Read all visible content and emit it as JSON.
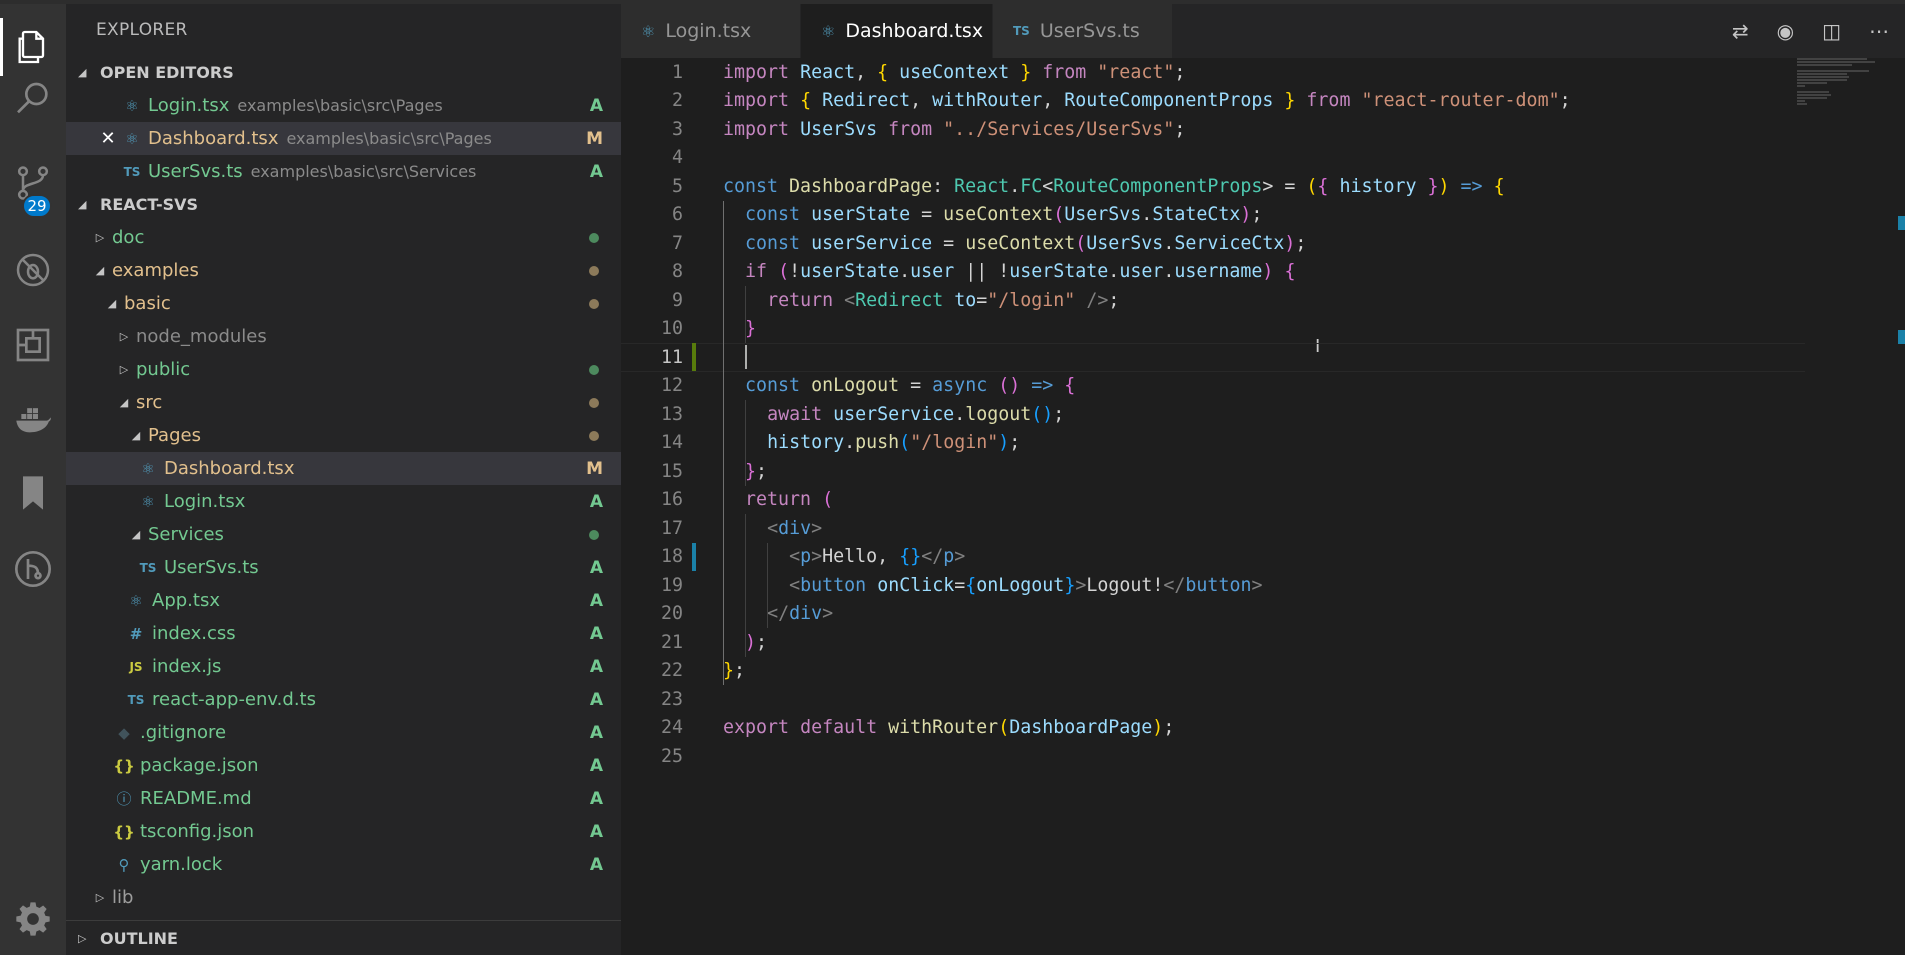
{
  "activity_bar": {
    "items": [
      "explorer-icon",
      "search-icon",
      "source-control-icon",
      "debug-icon",
      "extensions-icon",
      "docker-icon",
      "bookmarks-icon",
      "git-graph-icon"
    ],
    "scm_badge": "29",
    "settings": "gear-icon"
  },
  "sidebar": {
    "title": "EXPLORER",
    "open_editors_title": "OPEN EDITORS",
    "open_editors": [
      {
        "name": "Login.tsx",
        "path": "examples\\basic\\src\\Pages",
        "status": "A",
        "icon": "react-icon"
      },
      {
        "name": "Dashboard.tsx",
        "path": "examples\\basic\\src\\Pages",
        "status": "M",
        "icon": "react-icon",
        "close": "✕"
      },
      {
        "name": "UserSvs.ts",
        "path": "examples\\basic\\src\\Services",
        "status": "A",
        "icon": "TS"
      }
    ],
    "project_title": "REACT-SVS",
    "tree": [
      {
        "name": "doc"
      },
      {
        "name": "examples"
      },
      {
        "name": "basic"
      },
      {
        "name": "node_modules"
      },
      {
        "name": "public"
      },
      {
        "name": "src"
      },
      {
        "name": "Pages"
      },
      {
        "name": "Dashboard.tsx",
        "status": "M"
      },
      {
        "name": "Login.tsx",
        "status": "A"
      },
      {
        "name": "Services"
      },
      {
        "name": "UserSvs.ts",
        "status": "A",
        "icon": "TS"
      },
      {
        "name": "App.tsx",
        "status": "A"
      },
      {
        "name": "index.css",
        "status": "A",
        "icon": "#"
      },
      {
        "name": "index.js",
        "status": "A",
        "icon": "JS"
      },
      {
        "name": "react-app-env.d.ts",
        "status": "A",
        "icon": "TS"
      },
      {
        "name": ".gitignore",
        "status": "A"
      },
      {
        "name": "package.json",
        "status": "A",
        "icon": "{}"
      },
      {
        "name": "README.md",
        "status": "A",
        "icon": "ⓘ"
      },
      {
        "name": "tsconfig.json",
        "status": "A",
        "icon": "{}"
      },
      {
        "name": "yarn.lock",
        "status": "A"
      },
      {
        "name": "lib"
      }
    ],
    "outline_title": "OUTLINE"
  },
  "tabs": [
    {
      "label": "Login.tsx",
      "icon": "react-icon"
    },
    {
      "label": "Dashboard.tsx",
      "icon": "react-icon",
      "active": true
    },
    {
      "label": "UserSvs.ts",
      "icon": "TS"
    }
  ],
  "editor": {
    "line_numbers": [
      "1",
      "2",
      "3",
      "4",
      "5",
      "6",
      "7",
      "8",
      "9",
      "10",
      "11",
      "12",
      "13",
      "14",
      "15",
      "16",
      "17",
      "18",
      "19",
      "20",
      "21",
      "22",
      "23",
      "24",
      "25"
    ],
    "current_line": "11",
    "code": {
      "l1": [
        "import",
        " ",
        "React",
        ", ",
        "{",
        " ",
        "useContext",
        " ",
        "}",
        " ",
        "from",
        " ",
        "\"react\"",
        ";"
      ],
      "l2": [
        "import",
        " ",
        "{",
        " ",
        "Redirect",
        ", ",
        "withRouter",
        ", ",
        "RouteComponentProps",
        " ",
        "}",
        " ",
        "from",
        " ",
        "\"react-router-dom\"",
        ";"
      ],
      "l3": [
        "import",
        " ",
        "UserSvs",
        " ",
        "from",
        " ",
        "\"../Services/UserSvs\"",
        ";"
      ],
      "l5": [
        "const",
        " ",
        "DashboardPage",
        ": ",
        "React",
        ".",
        "FC",
        "<",
        "RouteComponentProps",
        "> = ",
        "(",
        "{",
        " ",
        "history",
        " ",
        "}",
        ")",
        " ",
        "=>",
        " ",
        "{"
      ],
      "l6": [
        "const",
        " ",
        "userState",
        " = ",
        "useContext",
        "(",
        "UserSvs",
        ".",
        "StateCtx",
        ")",
        ";"
      ],
      "l7": [
        "const",
        " ",
        "userService",
        " = ",
        "useContext",
        "(",
        "UserSvs",
        ".",
        "ServiceCtx",
        ")",
        ";"
      ],
      "l8": [
        "if",
        " ",
        "(",
        "!",
        "userState",
        ".",
        "user",
        " || !",
        "userState",
        ".",
        "user",
        ".",
        "username",
        ")",
        " ",
        "{"
      ],
      "l9": [
        "return",
        " ",
        "<",
        "Redirect",
        " ",
        "to",
        "=",
        "\"/login\"",
        " ",
        "/>",
        ";"
      ],
      "l10": [
        "}"
      ],
      "l12": [
        "const",
        " ",
        "onLogout",
        " = ",
        "async",
        " ",
        "(",
        ")",
        " ",
        "=>",
        " ",
        "{"
      ],
      "l13": [
        "await",
        " ",
        "userService",
        ".",
        "logout",
        "(",
        ")",
        ";"
      ],
      "l14": [
        "history",
        ".",
        "push",
        "(",
        "\"/login\"",
        ")",
        ";"
      ],
      "l15": [
        "}",
        ";"
      ],
      "l16": [
        "return",
        " ",
        "("
      ],
      "l17": [
        "<",
        "div",
        ">"
      ],
      "l18": [
        "<",
        "p",
        ">",
        "Hello, ",
        "{",
        "}",
        "</",
        "p",
        ">"
      ],
      "l19": [
        "<",
        "button",
        " ",
        "onClick",
        "=",
        "{",
        "onLogout",
        "}",
        ">",
        "Logout!",
        "</",
        "button",
        ">"
      ],
      "l20": [
        "</",
        "div",
        ">"
      ],
      "l21": [
        ")",
        ";"
      ],
      "l22": [
        "}",
        ";"
      ],
      "l24": [
        "export",
        " ",
        "default",
        " ",
        "withRouter",
        "(",
        "DashboardPage",
        ")",
        ";"
      ]
    }
  },
  "colors": {
    "added": "#73c991",
    "modified": "#e2c08d",
    "accent": "#007acc"
  }
}
